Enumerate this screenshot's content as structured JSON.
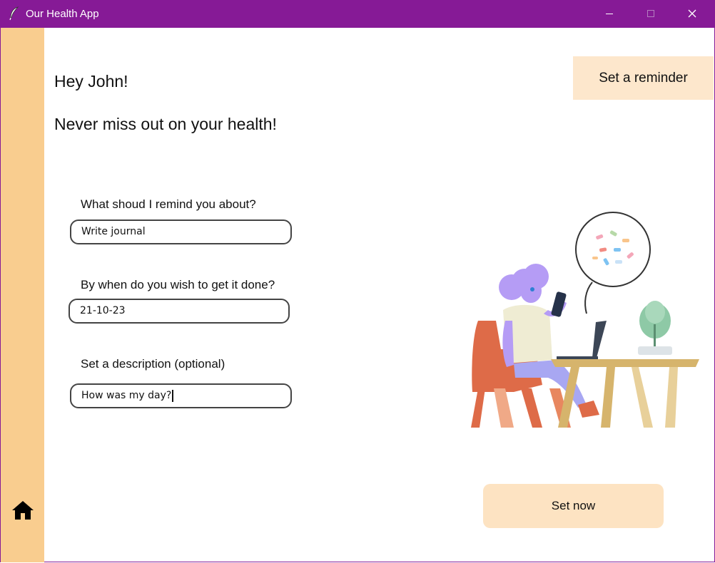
{
  "window": {
    "title": "Our Health App"
  },
  "header": {
    "greeting": "Hey John!",
    "subheading": "Never miss out on your health!"
  },
  "tab": {
    "label": "Set a reminder"
  },
  "form": {
    "reminder_label": "What shoud I remind you about?",
    "reminder_value": "Write journal",
    "deadline_label": "By when do you wish to get it done?",
    "deadline_value": "21-10-23",
    "description_label": "Set a description (optional)",
    "description_value": "How was my day?"
  },
  "actions": {
    "submit_label": "Set now"
  },
  "colors": {
    "titlebar": "#861a96",
    "sidebar": "#f9cd8f",
    "tab_bg": "#fde7cc",
    "button_bg": "#fde3c2"
  },
  "icons": {
    "app": "feather-icon",
    "nav_home": "home-icon"
  }
}
